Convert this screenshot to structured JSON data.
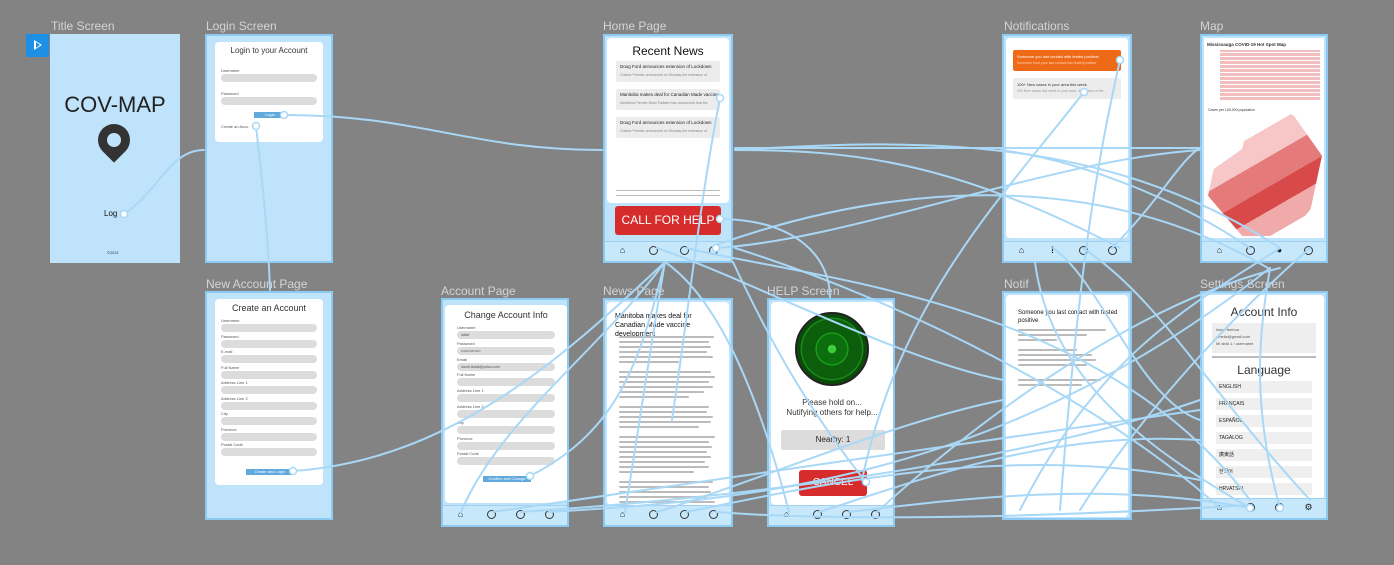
{
  "labels": {
    "title": "Title Screen",
    "login": "Login Screen",
    "home": "Home Page",
    "notifications": "Notifications",
    "map": "Map",
    "new_account": "New Account Page",
    "account": "Account Page",
    "news": "News Page",
    "help": "HELP Screen",
    "notif": "Notif",
    "settings": "Settings Screen"
  },
  "title_screen": {
    "app_name": "COV-MAP",
    "login": "Log",
    "copyright": "©2021"
  },
  "login_screen": {
    "heading": "Login to your Account",
    "username": "Username",
    "password": "Password",
    "login_button": "Login",
    "create_link": "Create an Acco"
  },
  "home": {
    "heading": "Recent News",
    "news": [
      {
        "title": "Doug Ford announces extension of Lockdown",
        "sub": "Ontario Premier announced on Monday the extension of"
      },
      {
        "title": "Manitoba makes deal for Canadian Made vaccine",
        "sub": "Manitoba Premier Brian Pallister has announced that the"
      },
      {
        "title": "Doug Ford announces extension of Lockdown",
        "sub": "Ontario Premier announced on Monday the extension of"
      }
    ],
    "call_button": "CALL FOR HELP"
  },
  "notifications": {
    "items": [
      {
        "title": "Someone you last contact with tested positive!",
        "sub": "Someone from your last contact has tested positive"
      },
      {
        "title": "100+ New cases in your area this week",
        "sub": "150 New cases this week in your area. 40+ cases in the"
      }
    ]
  },
  "map": {
    "title": "Mississauga COVID-19 Hot Spot Map",
    "legend": "Cases per 100,000 population"
  },
  "new_account": {
    "heading": "Create an Account",
    "fields": [
      "Username",
      "Password",
      "E-mail",
      "Full Name",
      "Address Line 1",
      "Address Line 2",
      "City",
      "Province",
      "Postal Code"
    ],
    "button": "Create and Login"
  },
  "account": {
    "heading": "Change Account Info",
    "fields": [
      {
        "label": "Username",
        "value": "dallef"
      },
      {
        "label": "Password",
        "value": "••••••••••••••••"
      },
      {
        "label": "Email",
        "value": "dandf.tbdda@yahoo.com"
      },
      {
        "label": "Full Name",
        "value": ""
      },
      {
        "label": "Address Line 1",
        "value": ""
      },
      {
        "label": "Address Line 2",
        "value": ""
      },
      {
        "label": "City",
        "value": ""
      },
      {
        "label": "Province",
        "value": ""
      },
      {
        "label": "Postal Code",
        "value": ""
      }
    ],
    "button": "Confirm and Change"
  },
  "news_page": {
    "heading": "Manitoba makes deal for Canadian Made vaccine development"
  },
  "help": {
    "hold": "Please hold on...",
    "notifying": "Nutifying others for help...",
    "nearby": "Nearby: 1",
    "cancel": "CANCEL"
  },
  "notif": {
    "heading": "Someone you last contact with tested positive"
  },
  "settings": {
    "heading": "Account Info",
    "lines": [
      "Issa Fleehoa",
      "amelia@gmail.com",
      "Mi abid 1 / username"
    ],
    "language_heading": "Language",
    "languages": [
      "ENGLISH",
      "FRANÇAIS",
      "ESPAÑOL",
      "TAGALOG",
      "廣東話",
      "한국어",
      "HRVATSKI"
    ]
  },
  "colors": {
    "background": "#838383",
    "frame": "#bfe3fb",
    "wire": "#a9d8f7",
    "alert_red": "#d62c2c",
    "notif_orange": "#ee6a17"
  }
}
